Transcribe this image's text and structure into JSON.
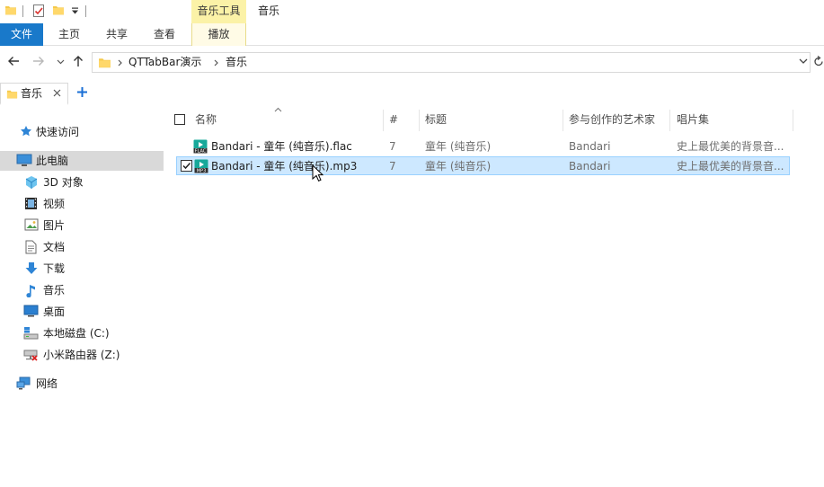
{
  "title_bar": {
    "context_group": "音乐工具",
    "window_title": "音乐"
  },
  "ribbon": {
    "tabs": [
      {
        "label": "文件",
        "active": true
      },
      {
        "label": "主页"
      },
      {
        "label": "共享"
      },
      {
        "label": "查看"
      },
      {
        "label": "播放"
      }
    ]
  },
  "address": {
    "crumbs": [
      "QTTabBar演示",
      "音乐"
    ]
  },
  "qttabs": {
    "tabs": [
      {
        "label": "音乐"
      }
    ],
    "add_label": "+"
  },
  "navigation": {
    "items": [
      {
        "label": "快速访问",
        "icon": "star-icon"
      },
      {
        "label": "此电脑",
        "icon": "computer-icon",
        "selected": true
      },
      {
        "label": "3D 对象",
        "icon": "cube-icon"
      },
      {
        "label": "视频",
        "icon": "video-icon"
      },
      {
        "label": "图片",
        "icon": "picture-icon"
      },
      {
        "label": "文档",
        "icon": "document-icon"
      },
      {
        "label": "下载",
        "icon": "download-icon"
      },
      {
        "label": "音乐",
        "icon": "music-icon"
      },
      {
        "label": "桌面",
        "icon": "desktop-icon"
      },
      {
        "label": "本地磁盘 (C:)",
        "icon": "drive-icon"
      },
      {
        "label": "小米路由器 (Z:)",
        "icon": "network-drive-icon"
      },
      {
        "label": "网络",
        "icon": "network-icon"
      }
    ]
  },
  "file_list": {
    "columns": [
      "名称",
      "#",
      "标题",
      "参与创作的艺术家",
      "唱片集"
    ],
    "files": [
      {
        "name": "Bandari - 童年 (纯音乐).flac",
        "track": "7",
        "title": "童年 (纯音乐)",
        "artist": "Bandari",
        "album": "史上最优美的背景音...",
        "icon": "flac-file-icon",
        "selected": false
      },
      {
        "name": "Bandari - 童年 (纯音乐).mp3",
        "track": "7",
        "title": "童年 (纯音乐)",
        "artist": "Bandari",
        "album": "史上最优美的背景音...",
        "icon": "mp3-file-icon",
        "selected": true
      }
    ]
  },
  "colors": {
    "file_tab": "#1979ca",
    "context_group": "#fbf2a7",
    "selection": "#cde8ff",
    "selection_border": "#99d1ff",
    "nav_selected": "#d9d9d9",
    "add_tab": "#1a6fd6"
  }
}
